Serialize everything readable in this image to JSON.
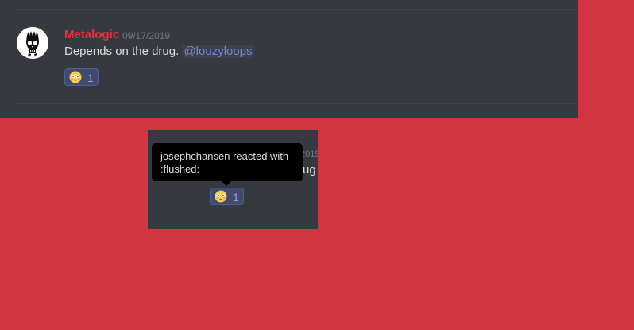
{
  "message": {
    "username": "Metalogic",
    "timestamp": "09/17/2019",
    "text": "Depends on the drug.",
    "mention": "@louzyloops",
    "reaction": {
      "emoji": "flushed-face-icon",
      "count": "1"
    }
  },
  "inset": {
    "timestamp_fragment": "2019",
    "text_fragment": "rug",
    "reaction": {
      "emoji": "flushed-face-icon",
      "count": "1"
    },
    "tooltip": {
      "line1": "josephchansen reacted with",
      "line2": ":flushed:"
    }
  },
  "colors": {
    "background": "#d13541",
    "panel": "#36393f",
    "username": "#e3323c",
    "mention": "#7289da",
    "reaction_bg": "#414b6d"
  }
}
